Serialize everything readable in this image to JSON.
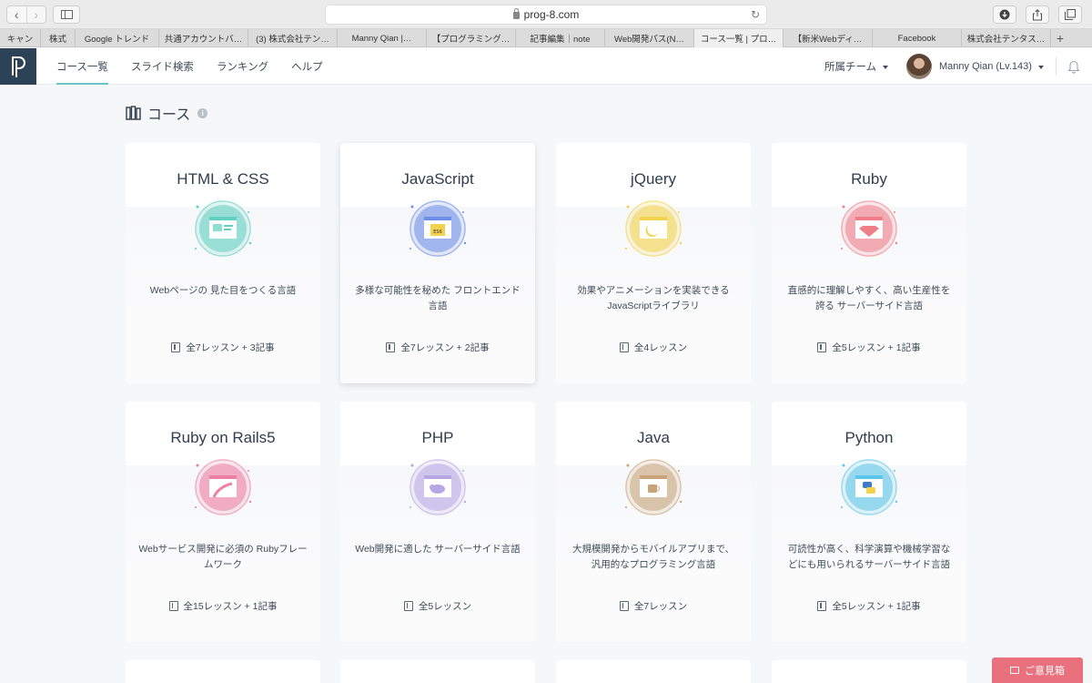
{
  "browser": {
    "url": "prog-8.com",
    "tabs": [
      {
        "label": "キャン",
        "w": 45
      },
      {
        "label": "株式",
        "w": 38
      },
      {
        "label": "Google トレンド",
        "w": 92
      },
      {
        "label": "共通アカウントバ…",
        "w": 98
      },
      {
        "label": "(3) 株式会社テン…",
        "w": 98
      },
      {
        "label": "Manny Qian |…",
        "w": 98
      },
      {
        "label": "【プログラミング…",
        "w": 98
      },
      {
        "label": "記事編集｜note",
        "w": 98
      },
      {
        "label": "Web開発パス(N…",
        "w": 98
      },
      {
        "label": "コース一覧 | プロ…",
        "w": 98
      },
      {
        "label": "【新米Webディ…",
        "w": 98
      },
      {
        "label": "Facebook",
        "w": 98
      },
      {
        "label": "株式会社テンタス…",
        "w": 98
      }
    ],
    "active_tab": 9
  },
  "header": {
    "nav": [
      "コース一覧",
      "スライド検索",
      "ランキング",
      "ヘルプ"
    ],
    "team_label": "所属チーム",
    "user_name": "Manny Qian (Lv.143)"
  },
  "section": {
    "title": "コース"
  },
  "courses": [
    {
      "title": "HTML & CSS",
      "desc": "Webページの 見た目をつくる言語",
      "meta": "全7レッスン + 3記事",
      "color": "#61cfc1",
      "icon": "html-css-icon"
    },
    {
      "title": "JavaScript",
      "desc": "多様な可能性を秘めた フロントエンド 言語",
      "meta": "全7レッスン + 2記事",
      "color": "#6d8ee6",
      "icon": "javascript-es6-icon"
    },
    {
      "title": "jQuery",
      "desc": "効果やアニメーションを実装できる JavaScriptライブラリ",
      "meta": "全4レッスン",
      "color": "#f2d34f",
      "icon": "jquery-icon"
    },
    {
      "title": "Ruby",
      "desc": "直感的に理解しやすく、高い生産性を 誇る サーバーサイド言語",
      "meta": "全5レッスン + 1記事",
      "color": "#f07e88",
      "icon": "ruby-gem-icon"
    },
    {
      "title": "Ruby on Rails5",
      "desc": "Webサービス開発に必須の Rubyフレー ムワーク",
      "meta": "全15レッスン + 1記事",
      "color": "#ec7fa3",
      "icon": "rails-icon"
    },
    {
      "title": "PHP",
      "desc": "Web開発に適した サーバーサイド言語",
      "meta": "全5レッスン",
      "color": "#b6a7e4",
      "icon": "php-elephant-icon"
    },
    {
      "title": "Java",
      "desc": "大規模開発からモバイルアプリまで、 汎用的なプログラミング言語",
      "meta": "全7レッスン",
      "color": "#c9a47a",
      "icon": "java-cup-icon"
    },
    {
      "title": "Python",
      "desc": "可読性が高く、科学演算や機械学習な どにも用いられるサーバーサイド言語",
      "meta": "全5レッスン + 1記事",
      "color": "#5cc6ea",
      "icon": "python-icon"
    }
  ],
  "feedback_label": "ご意見箱",
  "colors": {
    "logo_bg": "#2c4357",
    "nav_underline": "#6ac6c4",
    "feedback_bg": "#e8717d"
  }
}
